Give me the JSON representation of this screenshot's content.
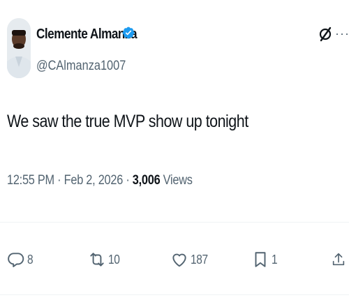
{
  "author": {
    "name": "Clemente Almanza",
    "handle": "@CAlmanza1007",
    "verified": true
  },
  "tweet": {
    "text": "We saw the true MVP show up tonight"
  },
  "meta": {
    "time": "12:55 PM",
    "separator1": " · ",
    "date": "Feb 2, 2026",
    "separator2": " · ",
    "views_count": "3,006",
    "views_label": " Views"
  },
  "actions": {
    "replies": "8",
    "reposts": "10",
    "likes": "187",
    "bookmarks": "1"
  },
  "icons": {
    "verified": "verified-badge-icon",
    "grok": "grok-icon",
    "more": "more-icon",
    "reply": "reply-icon",
    "repost": "repost-icon",
    "like": "heart-icon",
    "bookmark": "bookmark-icon",
    "share": "share-icon"
  },
  "colors": {
    "text": "#0f1419",
    "secondary": "#536471",
    "verified": "#1d9bf0",
    "divider": "#eff3f4"
  }
}
